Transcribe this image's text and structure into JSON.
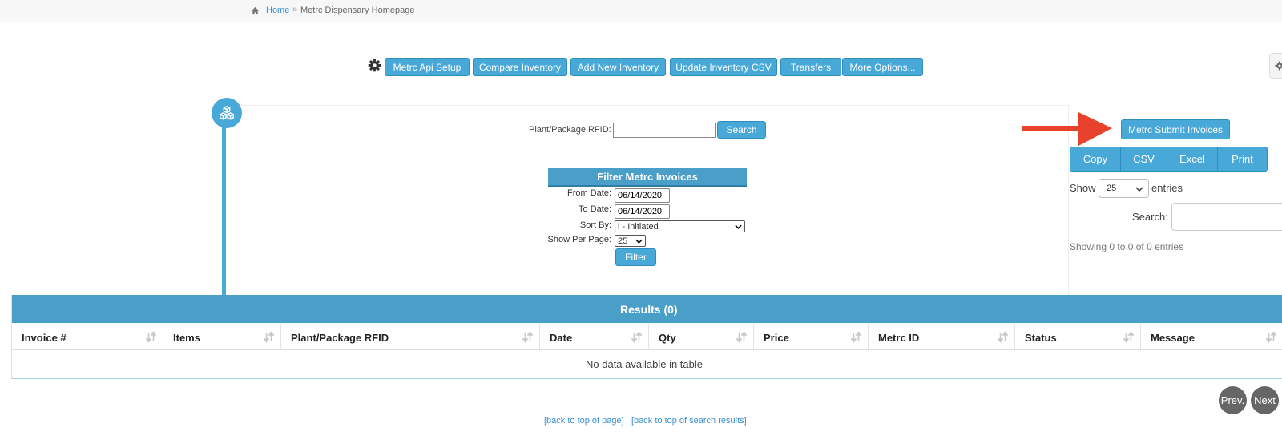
{
  "breadcrumb": {
    "home": "Home",
    "separator": "»",
    "current": "Metrc Dispensary Homepage"
  },
  "toolbar": {
    "buttons": [
      "Metrc Api Setup",
      "Compare Inventory",
      "Add New Inventory",
      "Update Inventory CSV",
      "Transfers",
      "More Options..."
    ]
  },
  "search": {
    "rfid_label": "Plant/Package RFID:",
    "rfid_value": "",
    "search_label": "Search"
  },
  "filter": {
    "title": "Filter Metrc Invoices",
    "from_label": "From Date:",
    "from_value": "06/14/2020",
    "to_label": "To Date:",
    "to_value": "06/14/2020",
    "sort_label": "Sort By:",
    "sort_value": "i - Initiated",
    "per_page_label": "Show Per Page:",
    "per_page_value": "25",
    "filter_label": "Filter"
  },
  "side": {
    "submit_label": "Metrc Submit Invoices",
    "export": [
      "Copy",
      "CSV",
      "Excel",
      "Print"
    ],
    "show_label": "Show",
    "show_value": "25",
    "entries_label": "entries",
    "search_label": "Search:",
    "info": "Showing 0 to 0 of 0 entries"
  },
  "results": {
    "title": "Results (0)",
    "columns": [
      "Invoice #",
      "Items",
      "Plant/Package RFID",
      "Date",
      "Qty",
      "Price",
      "Metrc ID",
      "Status",
      "Message"
    ],
    "empty": "No data available in table"
  },
  "pagination": {
    "prev": "Prev.",
    "next": "Next"
  },
  "footer": {
    "top_of_page": "[back to top of page]",
    "top_of_results": "[back to top of search results]"
  },
  "colors": {
    "accent": "#48a8d8",
    "header": "#4a9fc8",
    "arrow": "#e8412c",
    "link": "#3b8fd0"
  }
}
